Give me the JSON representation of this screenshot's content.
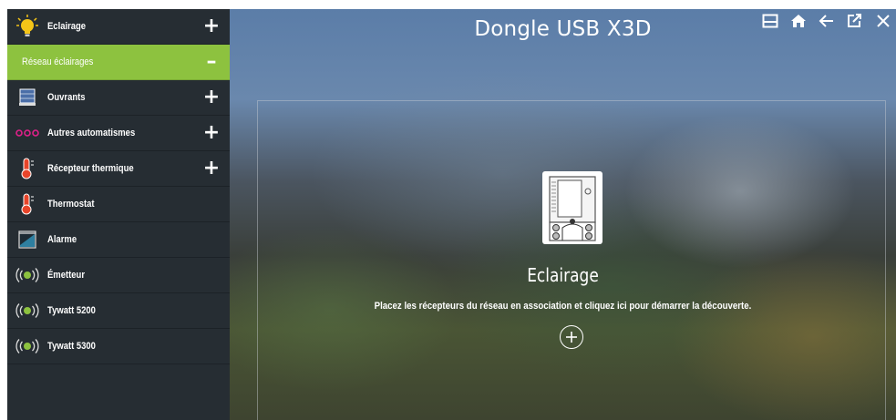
{
  "header": {
    "title": "Dongle USB X3D"
  },
  "toolbar": {
    "icons": [
      "print-icon",
      "home-icon",
      "back-arrow-icon",
      "external-link-icon",
      "close-icon"
    ]
  },
  "sidebar": {
    "items": [
      {
        "label": "Eclairage",
        "icon": "lightbulb-icon",
        "expander": "+",
        "active": false
      },
      {
        "label": "Réseau éclairages",
        "icon": "",
        "expander": "–",
        "active": true
      },
      {
        "label": "Ouvrants",
        "icon": "shutter-icon",
        "expander": "+",
        "active": false
      },
      {
        "label": "Autres automatismes",
        "icon": "dots-icon",
        "expander": "+",
        "active": false
      },
      {
        "label": "Récepteur thermique",
        "icon": "thermometer-icon",
        "expander": "+",
        "active": false
      },
      {
        "label": "Thermostat",
        "icon": "thermometer-icon",
        "expander": "",
        "active": false
      },
      {
        "label": "Alarme",
        "icon": "alarm-icon",
        "expander": "",
        "active": false
      },
      {
        "label": "Émetteur",
        "icon": "transmitter-icon",
        "expander": "",
        "active": false
      },
      {
        "label": "Tywatt 5200",
        "icon": "transmitter-icon",
        "expander": "",
        "active": false
      },
      {
        "label": "Tywatt 5300",
        "icon": "transmitter-icon",
        "expander": "",
        "active": false
      }
    ]
  },
  "main": {
    "device_name": "Eclairage",
    "instruction": "Placez les récepteurs du réseau en association et cliquez ici pour démarrer la découverte.",
    "device_icon": "lighting-receiver-icon",
    "discover_icon": "plus-circle-icon"
  },
  "colors": {
    "sidebar_bg": "#262d33",
    "active_item": "#8dc23f",
    "bulb": "#f5c518",
    "dots": "#e0208a",
    "thermo": "#e8452a",
    "signal": "#8dc23f"
  }
}
